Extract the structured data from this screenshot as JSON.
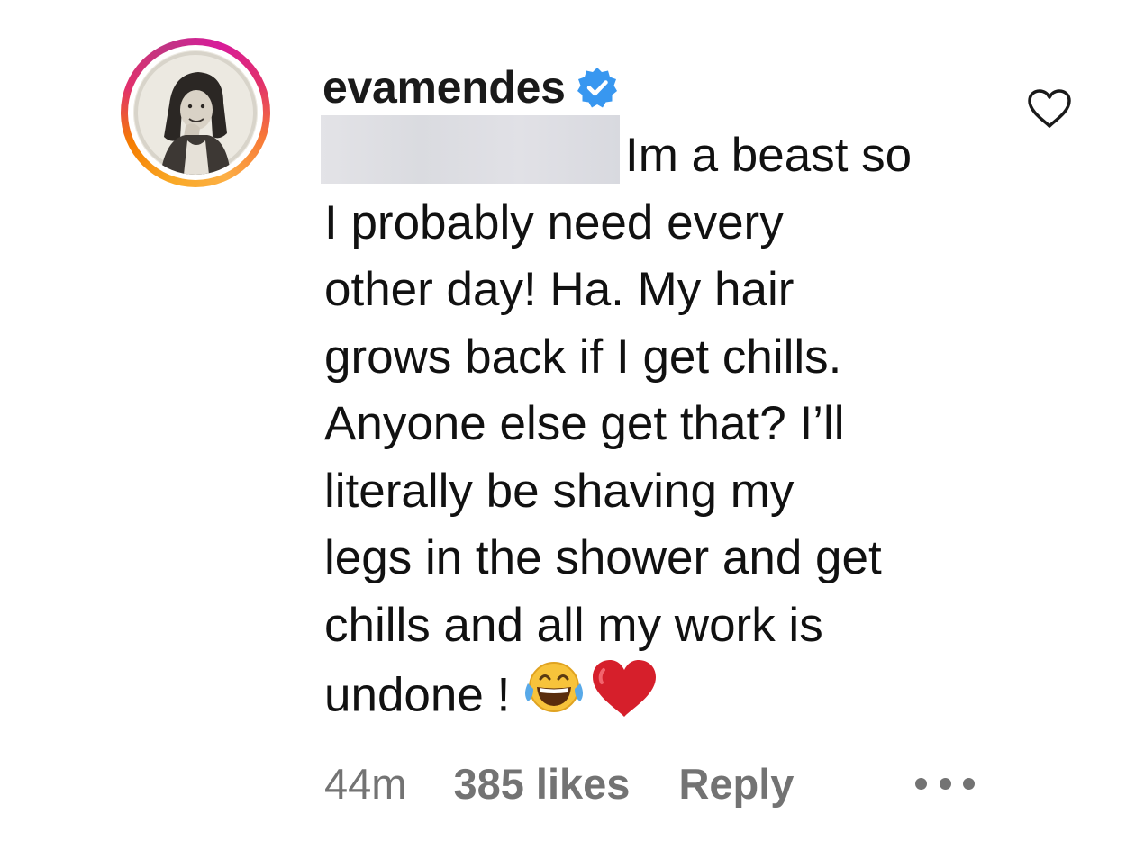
{
  "comment": {
    "username": "evamendes",
    "verified": true,
    "text_lines": [
      "Im a beast so",
      "I probably need every",
      "other day! Ha. My hair",
      "grows back if I get chills.",
      "Anyone else get that? I’ll",
      "literally be shaving my",
      "legs in the shower and get",
      "chills and all my work is",
      "undone !"
    ],
    "emojis": [
      "tears-of-joy-emoji",
      "red-heart-emoji"
    ],
    "timestamp": "44m",
    "likes": "385 likes",
    "reply_label": "Reply"
  },
  "icons": {
    "like": "heart-outline-icon",
    "more": "more-options-icon",
    "verified": "verified-badge-icon"
  },
  "colors": {
    "verified_blue": "#3897f0",
    "meta_gray": "#737373",
    "heart_red": "#d61f2b"
  }
}
